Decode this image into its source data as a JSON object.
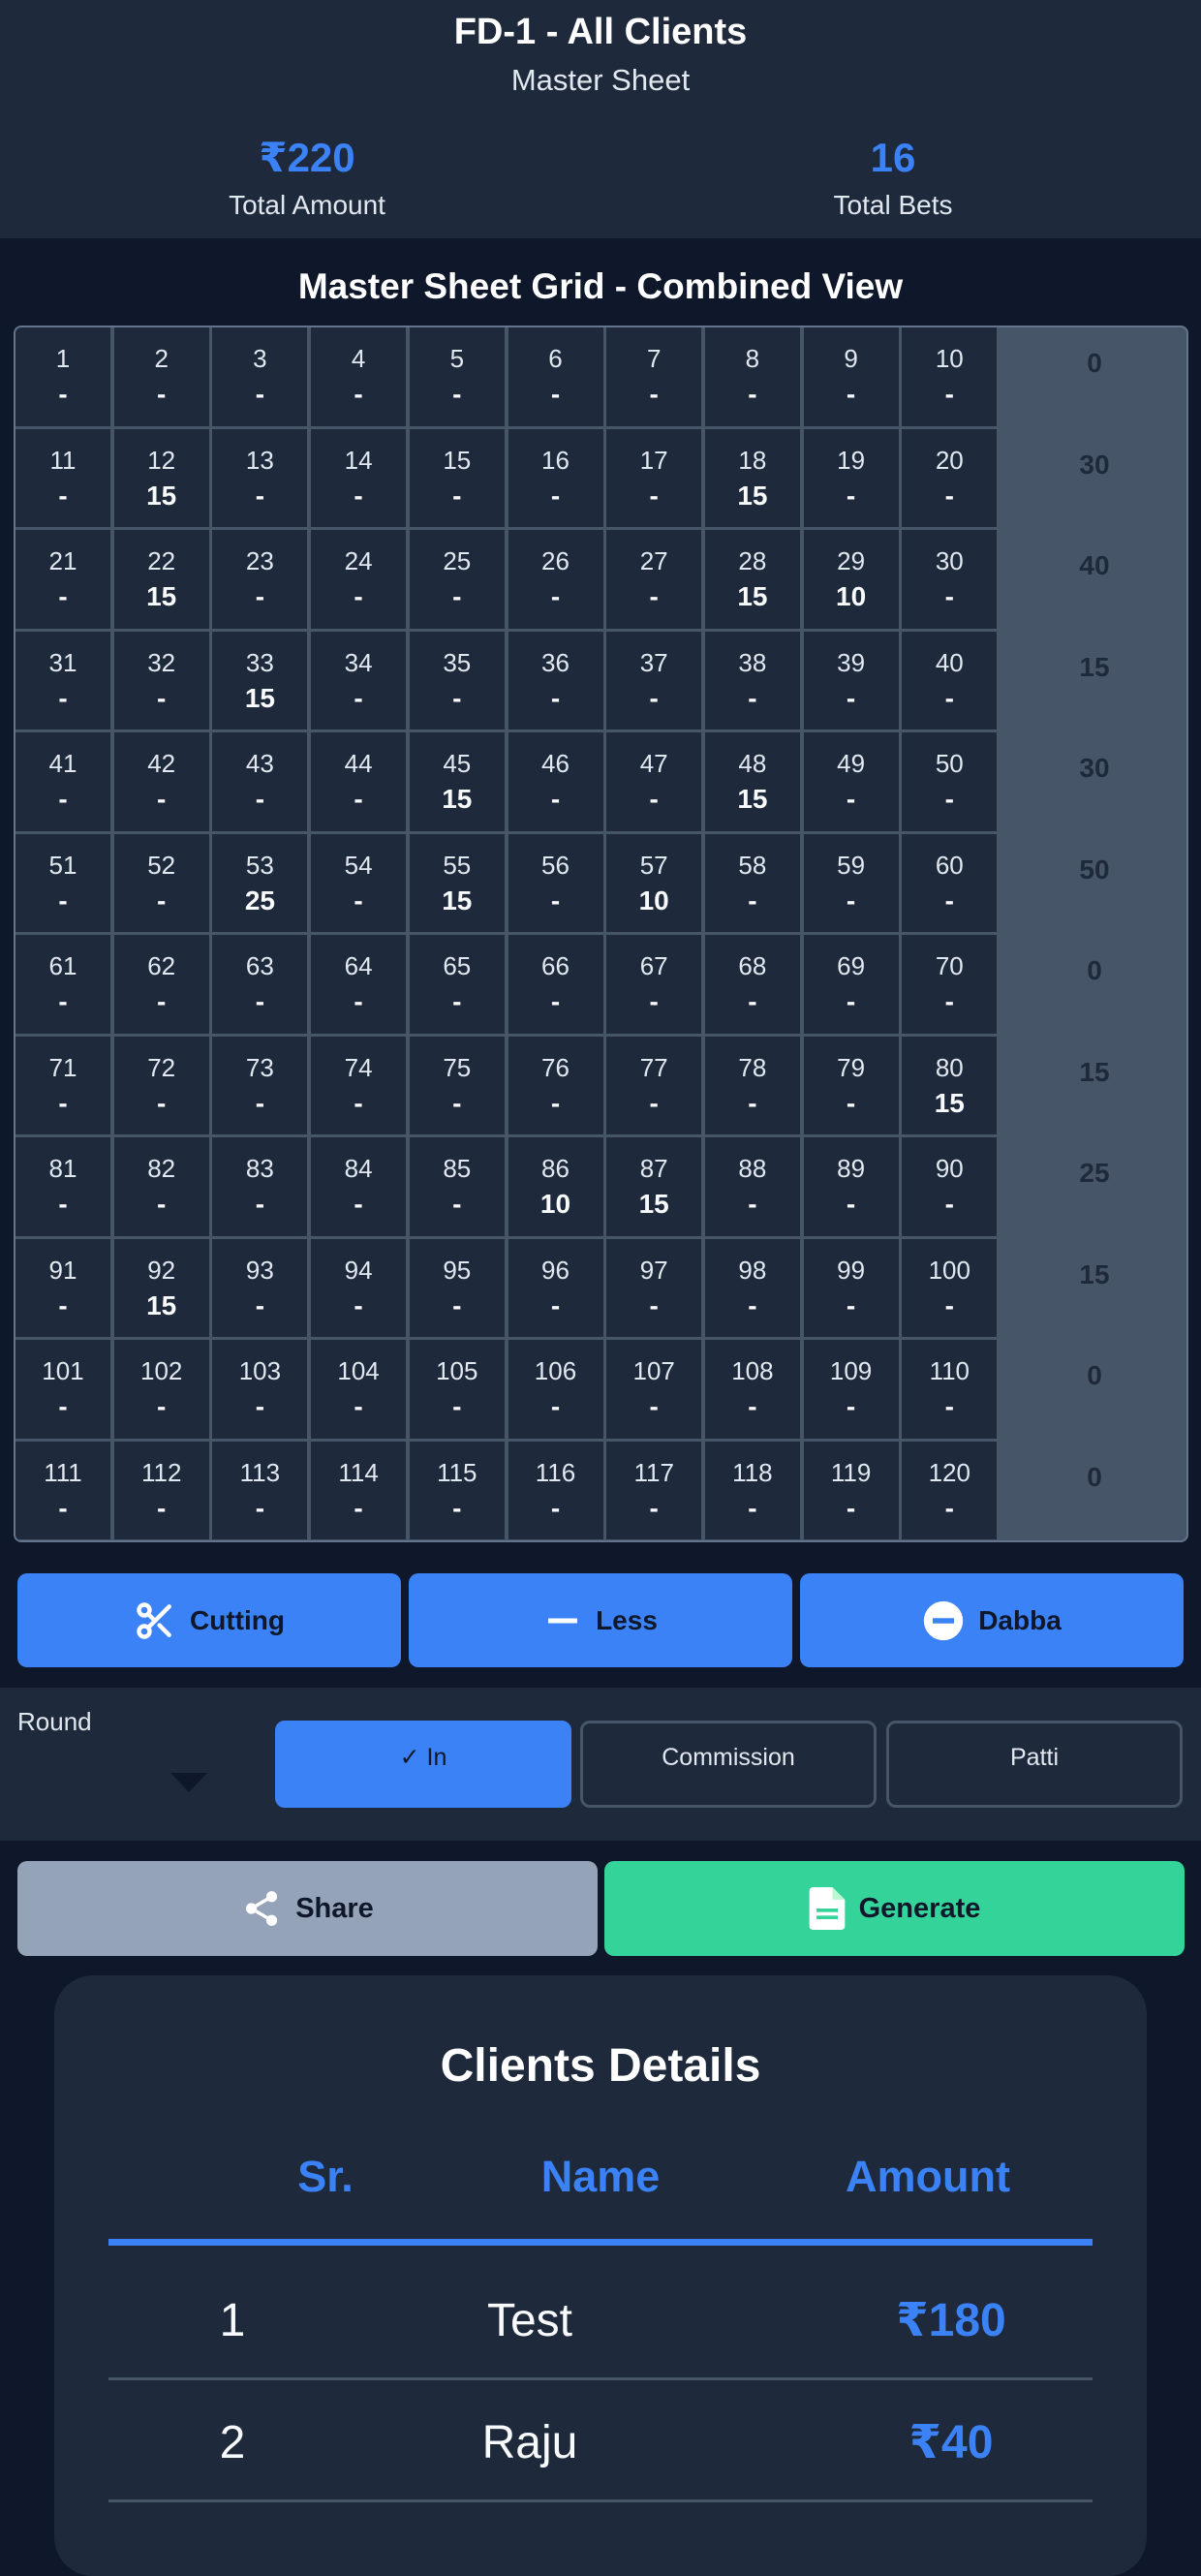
{
  "header": {
    "title": "FD-1 - All Clients",
    "subtitle": "Master Sheet",
    "stats": [
      {
        "value": "₹220",
        "label": "Total Amount"
      },
      {
        "value": "16",
        "label": "Total Bets"
      }
    ]
  },
  "grid": {
    "title": "Master Sheet Grid - Combined View",
    "columns": 10,
    "rows": [
      {
        "numbers": [
          "1",
          "2",
          "3",
          "4",
          "5",
          "6",
          "7",
          "8",
          "9",
          "10"
        ],
        "values": [
          "-",
          "-",
          "-",
          "-",
          "-",
          "-",
          "-",
          "-",
          "-",
          "-"
        ],
        "total": "0"
      },
      {
        "numbers": [
          "11",
          "12",
          "13",
          "14",
          "15",
          "16",
          "17",
          "18",
          "19",
          "20"
        ],
        "values": [
          "-",
          "15",
          "-",
          "-",
          "-",
          "-",
          "-",
          "15",
          "-",
          "-"
        ],
        "total": "30"
      },
      {
        "numbers": [
          "21",
          "22",
          "23",
          "24",
          "25",
          "26",
          "27",
          "28",
          "29",
          "30"
        ],
        "values": [
          "-",
          "15",
          "-",
          "-",
          "-",
          "-",
          "-",
          "15",
          "10",
          "-"
        ],
        "total": "40"
      },
      {
        "numbers": [
          "31",
          "32",
          "33",
          "34",
          "35",
          "36",
          "37",
          "38",
          "39",
          "40"
        ],
        "values": [
          "-",
          "-",
          "15",
          "-",
          "-",
          "-",
          "-",
          "-",
          "-",
          "-"
        ],
        "total": "15"
      },
      {
        "numbers": [
          "41",
          "42",
          "43",
          "44",
          "45",
          "46",
          "47",
          "48",
          "49",
          "50"
        ],
        "values": [
          "-",
          "-",
          "-",
          "-",
          "15",
          "-",
          "-",
          "15",
          "-",
          "-"
        ],
        "total": "30"
      },
      {
        "numbers": [
          "51",
          "52",
          "53",
          "54",
          "55",
          "56",
          "57",
          "58",
          "59",
          "60"
        ],
        "values": [
          "-",
          "-",
          "25",
          "-",
          "15",
          "-",
          "10",
          "-",
          "-",
          "-"
        ],
        "total": "50"
      },
      {
        "numbers": [
          "61",
          "62",
          "63",
          "64",
          "65",
          "66",
          "67",
          "68",
          "69",
          "70"
        ],
        "values": [
          "-",
          "-",
          "-",
          "-",
          "-",
          "-",
          "-",
          "-",
          "-",
          "-"
        ],
        "total": "0"
      },
      {
        "numbers": [
          "71",
          "72",
          "73",
          "74",
          "75",
          "76",
          "77",
          "78",
          "79",
          "80"
        ],
        "values": [
          "-",
          "-",
          "-",
          "-",
          "-",
          "-",
          "-",
          "-",
          "-",
          "15"
        ],
        "total": "15"
      },
      {
        "numbers": [
          "81",
          "82",
          "83",
          "84",
          "85",
          "86",
          "87",
          "88",
          "89",
          "90"
        ],
        "values": [
          "-",
          "-",
          "-",
          "-",
          "-",
          "10",
          "15",
          "-",
          "-",
          "-"
        ],
        "total": "25"
      },
      {
        "numbers": [
          "91",
          "92",
          "93",
          "94",
          "95",
          "96",
          "97",
          "98",
          "99",
          "100"
        ],
        "values": [
          "-",
          "15",
          "-",
          "-",
          "-",
          "-",
          "-",
          "-",
          "-",
          "-"
        ],
        "total": "15"
      },
      {
        "numbers": [
          "101",
          "102",
          "103",
          "104",
          "105",
          "106",
          "107",
          "108",
          "109",
          "110"
        ],
        "values": [
          "-",
          "-",
          "-",
          "-",
          "-",
          "-",
          "-",
          "-",
          "-",
          "-"
        ],
        "total": "0"
      },
      {
        "numbers": [
          "111",
          "112",
          "113",
          "114",
          "115",
          "116",
          "117",
          "118",
          "119",
          "120"
        ],
        "values": [
          "-",
          "-",
          "-",
          "-",
          "-",
          "-",
          "-",
          "-",
          "-",
          "-"
        ],
        "total": "0"
      }
    ]
  },
  "actions": {
    "cutting": {
      "label": "Cutting",
      "icon": "scissors-icon"
    },
    "less": {
      "label": "Less",
      "icon": "minus-icon"
    },
    "dabba": {
      "label": "Dabba",
      "icon": "minus-circle-icon"
    }
  },
  "round": {
    "label": "Round",
    "options": [
      "✓ In",
      "Commission",
      "Patti"
    ],
    "active_option": "✓ In"
  },
  "buttons": {
    "share": {
      "label": "Share",
      "icon": "share-icon"
    },
    "generate": {
      "label": "Generate",
      "icon": "document-icon"
    }
  },
  "clients": {
    "title": "Clients Details",
    "headers": [
      "Sr.",
      "Name",
      "Amount"
    ],
    "rows": [
      {
        "sr": "1",
        "name": "Test",
        "amount": "₹180"
      },
      {
        "sr": "2",
        "name": "Raju",
        "amount": "₹40"
      }
    ]
  },
  "colors": {
    "background": "#0f172a",
    "panel": "#1e293b",
    "accent": "#3b82f6",
    "generate": "#34d399",
    "share": "#94a3b8",
    "row_total": "#475569"
  }
}
